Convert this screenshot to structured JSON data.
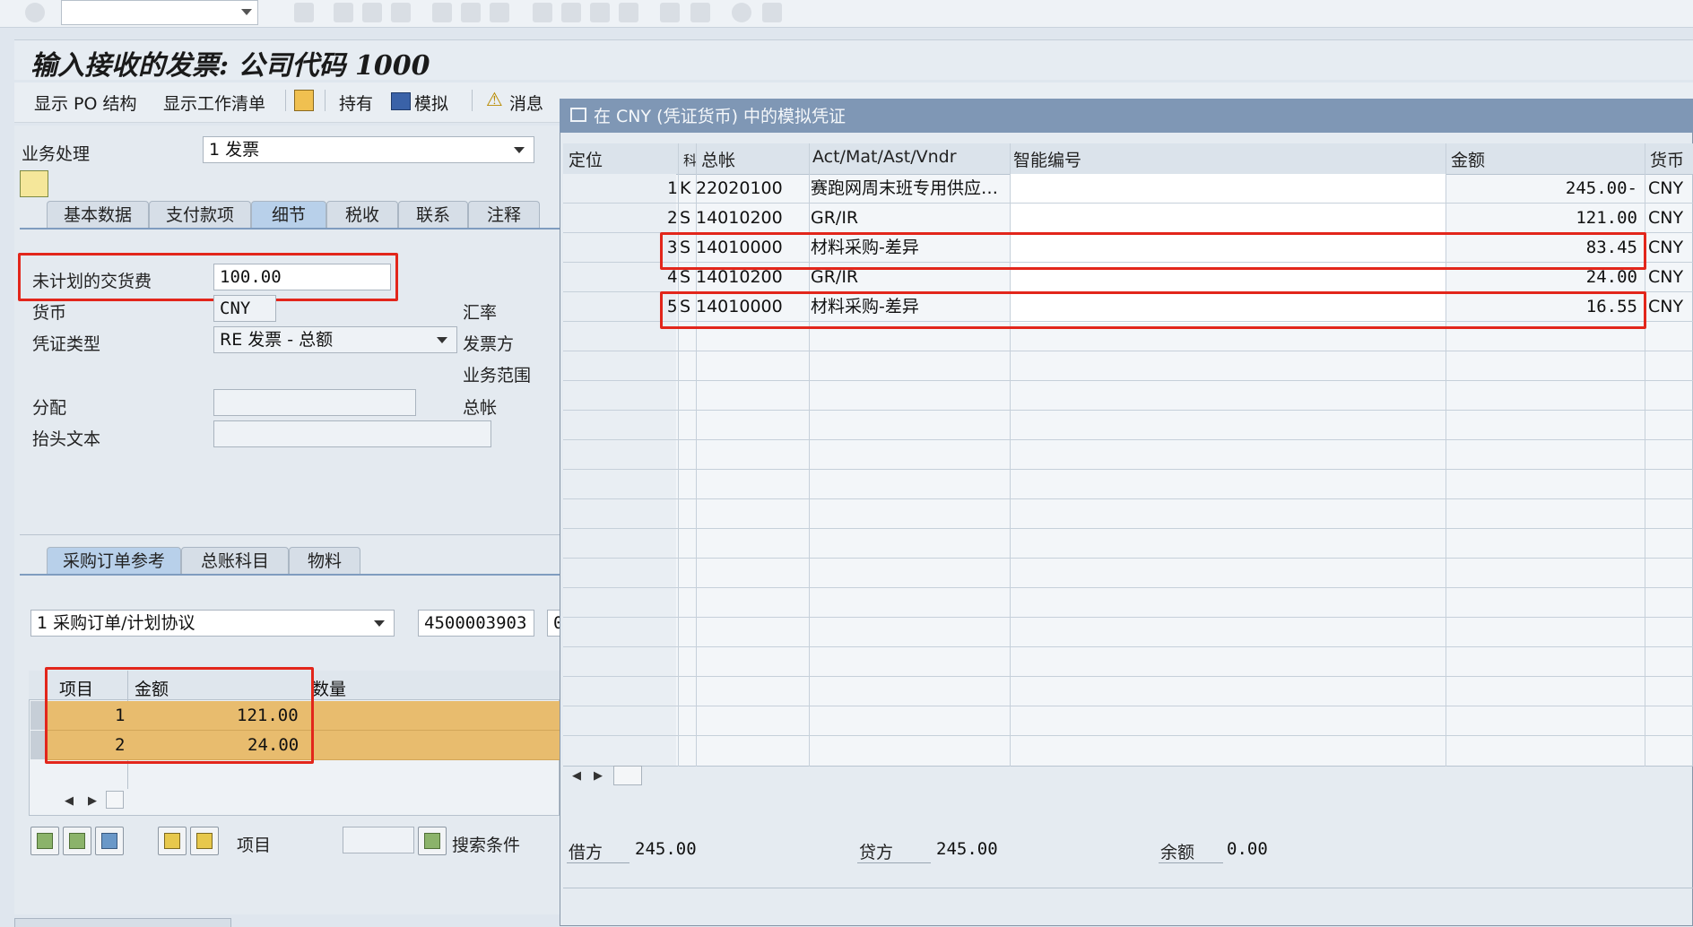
{
  "page_title": "输入接收的发票: 公司代码 1000",
  "toolbar": {
    "show_po_structure": "显示 PO 结构",
    "show_worklist": "显示工作清单",
    "hold": "持有",
    "simulate": "模拟",
    "messages": "消息"
  },
  "left": {
    "transaction_label": "业务处理",
    "transaction_value": "1 发票",
    "tabs": [
      "基本数据",
      "支付款项",
      "细节",
      "税收",
      "联系",
      "注释"
    ],
    "unplanned_delivery_cost_label": "未计划的交货费",
    "unplanned_delivery_cost_value": "100.00",
    "currency_label": "货币",
    "currency_value": "CNY",
    "exchange_rate_label": "汇率",
    "doc_type_label": "凭证类型",
    "doc_type_value": "RE 发票 - 总额",
    "invoicing_party_label": "发票方",
    "business_area_label": "业务范围",
    "assignment_label": "分配",
    "gl_label": "总帐",
    "header_text_label": "抬头文本",
    "po_tabs": [
      "采购订单参考",
      "总账科目",
      "物料"
    ],
    "ref_type_value": "1 采购订单/计划协议",
    "po_number": "4500003903",
    "po_extra": "0",
    "po_table": {
      "headers": [
        "项目",
        "金额",
        "数量"
      ],
      "rows": [
        {
          "item": "1",
          "amount": "121.00"
        },
        {
          "item": "2",
          "amount": "24.00"
        }
      ]
    },
    "item_label": "项目",
    "search_criteria": "搜索条件"
  },
  "dialog": {
    "title": "在 CNY (凭证货币) 中的模拟凭证",
    "headers": [
      "定位",
      "科",
      "总帐",
      "Act/Mat/Ast/Vndr",
      "智能编号",
      "金额",
      "货币"
    ],
    "rows": [
      {
        "pos": "1",
        "type": "K",
        "gl": "22020100",
        "name": "赛跑网周末班专用供应…",
        "amount": "245.00-",
        "currency": "CNY"
      },
      {
        "pos": "2",
        "type": "S",
        "gl": "14010200",
        "name": "GR/IR",
        "amount": "121.00",
        "currency": "CNY"
      },
      {
        "pos": "3",
        "type": "S",
        "gl": "14010000",
        "name": "材料采购-差异",
        "amount": "83.45",
        "currency": "CNY"
      },
      {
        "pos": "4",
        "type": "S",
        "gl": "14010200",
        "name": "GR/IR",
        "amount": "24.00",
        "currency": "CNY"
      },
      {
        "pos": "5",
        "type": "S",
        "gl": "14010000",
        "name": "材料采购-差异",
        "amount": "16.55",
        "currency": "CNY"
      }
    ],
    "debit_label": "借方",
    "debit_value": "245.00",
    "credit_label": "贷方",
    "credit_value": "245.00",
    "balance_label": "余额",
    "balance_value": "0.00"
  }
}
